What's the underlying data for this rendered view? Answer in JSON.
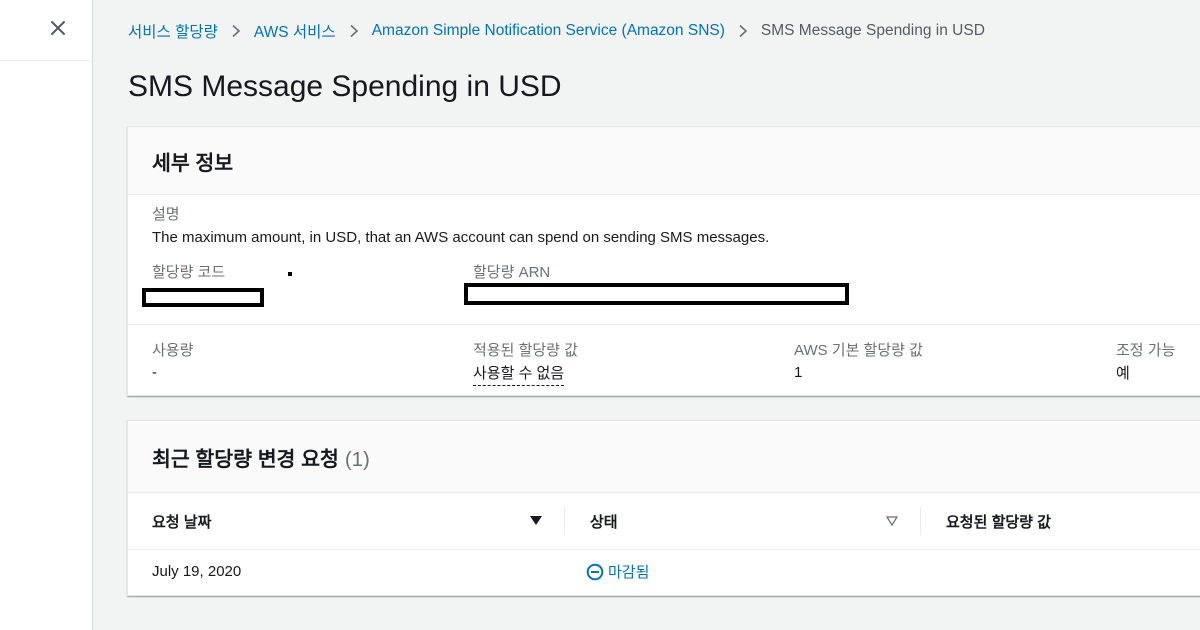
{
  "breadcrumb": {
    "items": [
      "서비스 할당량",
      "AWS 서비스",
      "Amazon Simple Notification Service (Amazon SNS)"
    ],
    "current": "SMS Message Spending in USD"
  },
  "page": {
    "title": "SMS Message Spending in USD"
  },
  "details": {
    "title": "세부 정보",
    "description_label": "설명",
    "description": "The maximum amount, in USD, that an AWS account can spend on sending SMS messages.",
    "quota_code_label": "할당량 코드",
    "quota_arn_label": "할당량 ARN",
    "usage_label": "사용량",
    "usage_value": "-",
    "applied_label": "적용된 할당량 값",
    "applied_value": "사용할 수 없음",
    "default_label": "AWS 기본 할당량 값",
    "default_value": "1",
    "adjustable_label": "조정 가능",
    "adjustable_value": "예"
  },
  "requests": {
    "title": "최근 할당량 변경 요청",
    "count": "(1)",
    "columns": [
      "요청 날짜",
      "상태",
      "요청된 할당량 값"
    ],
    "rows": [
      {
        "date": "July 19, 2020",
        "status": "마감됨",
        "requested": ""
      }
    ]
  },
  "icons": {
    "close": "close-icon",
    "chevron": "chevron-right-icon",
    "sort_active": "sort-descending-icon",
    "sort_inactive": "sort-icon",
    "status": "minus-circle-icon"
  },
  "colors": {
    "link": "#0073bb",
    "text": "#16191f",
    "label": "#687078"
  }
}
